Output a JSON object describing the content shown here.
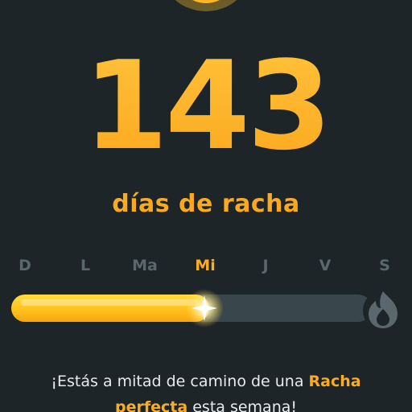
{
  "streak": {
    "count": "143",
    "label": "días de racha"
  },
  "week": {
    "days": [
      {
        "label": "D",
        "today": false
      },
      {
        "label": "L",
        "today": false
      },
      {
        "label": "Ma",
        "today": false
      },
      {
        "label": "Mi",
        "today": true
      },
      {
        "label": "J",
        "today": false
      },
      {
        "label": "V",
        "today": false
      },
      {
        "label": "S",
        "today": false
      }
    ],
    "progress_fraction": 0.55,
    "goal_icon": "flame-icon"
  },
  "message": {
    "part1": "¡Estás a mitad de camino de una ",
    "highlight1": "Racha",
    "part2": " ",
    "highlight2": "perfecta",
    "part3": " esta semana!"
  },
  "colors": {
    "background": "#1d2528",
    "accent": "#fba91e",
    "fill": "#ffc21e",
    "track": "#39464b",
    "inactive_day": "#5a676c"
  }
}
